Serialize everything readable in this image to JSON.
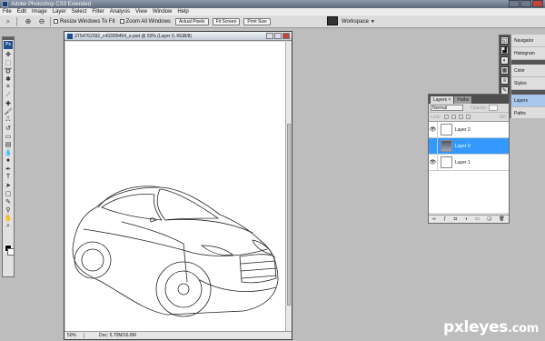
{
  "app": {
    "title": "Adobe Photoshop CS3 Extended"
  },
  "menu": [
    "File",
    "Edit",
    "Image",
    "Layer",
    "Select",
    "Filter",
    "Analysis",
    "View",
    "Window",
    "Help"
  ],
  "options": {
    "resize_label": "Resize Windows To Fit",
    "zoom_all_label": "Zoom All Windows",
    "actual_pixels": "Actual Pixels",
    "fit_screen": "Fit Screen",
    "print_size": "Print Size",
    "workspace": "Workspace"
  },
  "document": {
    "title": "3T54762392_c4335f9454_o.psd @ 50% (Layer 0, RGB/8)",
    "zoom": "50%",
    "doc_size": "Doc: 5.70M/16.8M"
  },
  "panels": {
    "dock_items": [
      "Navigator",
      "Histogram",
      "Color",
      "Styles",
      "Layers",
      "Paths"
    ]
  },
  "layers_panel": {
    "tabs": [
      "Layers",
      "Paths"
    ],
    "blend_mode": "Normal",
    "opacity_label": "Opacity:",
    "lock_label": "Lock:",
    "fill_label": "Fill:",
    "layers": [
      {
        "name": "Layer 2",
        "visible": true
      },
      {
        "name": "Layer 0",
        "visible": false
      },
      {
        "name": "Layer 1",
        "visible": true
      }
    ]
  },
  "watermark": {
    "text": "pxleyes",
    "suffix": ".com"
  },
  "colors": {
    "selection": "#3399ff",
    "title_bar": "#5d6a7e"
  }
}
